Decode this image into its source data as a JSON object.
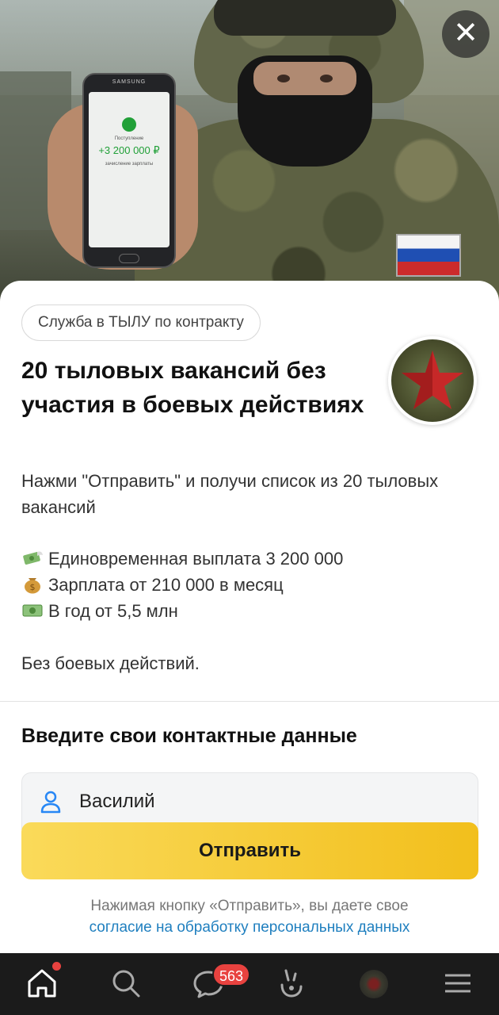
{
  "ad": {
    "close_icon": "close-icon",
    "photo": {
      "phone_brand": "SAMSUNG",
      "phone_label": "Поступление",
      "phone_amount": "+3 200 000 ₽",
      "phone_sub": "зачисление зарплаты"
    },
    "chip": "Служба в ТЫЛУ по контракту",
    "title": "20 тыловых вакансий без участия в боевых действиях",
    "logo_icon": "red-star-icon",
    "description": "Нажми \"Отправить\" и получи список из 20 тыловых вакансий",
    "bullets": [
      {
        "icon": "money-wings-icon",
        "text": "Единовременная выплата 3 200 000"
      },
      {
        "icon": "money-bag-icon",
        "text": "Зарплата от 210 000 в месяц"
      },
      {
        "icon": "dollar-banknote-icon",
        "text": "В год от 5,5 млн"
      }
    ],
    "footnote": "Без боевых действий."
  },
  "form": {
    "title": "Введите свои контактные данные",
    "name_value": "Василий",
    "submit_label": "Отправить",
    "consent_text": "Нажимая кнопку «Отправить», вы даете свое",
    "consent_link": "согласие на обработку персональных данных"
  },
  "nav": {
    "items": [
      "home-icon",
      "search-icon",
      "messages-icon",
      "clips-icon",
      "profile-avatar",
      "menu-icon"
    ],
    "messages_badge": "563"
  },
  "colors": {
    "button": "#f5c526",
    "badge": "#e8423f",
    "link": "#1f7fbf"
  }
}
